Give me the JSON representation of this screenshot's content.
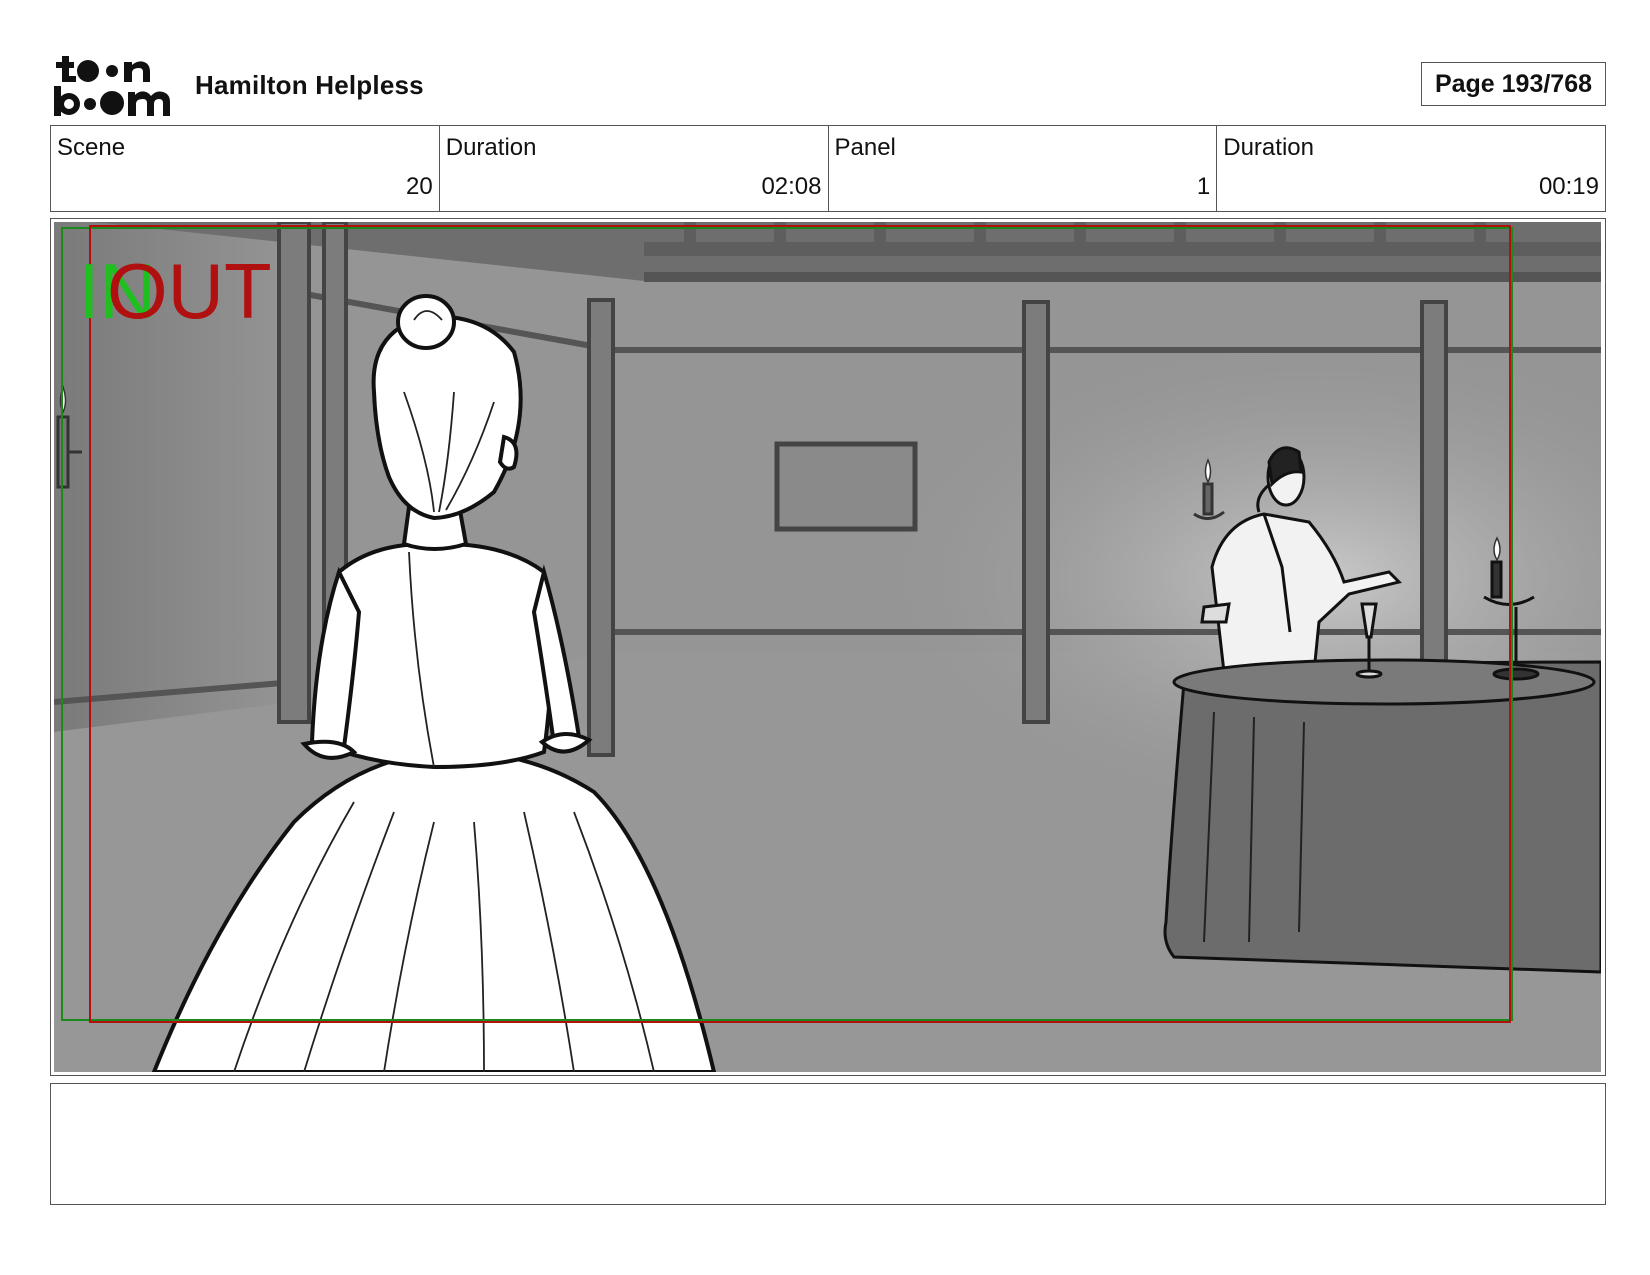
{
  "header": {
    "logo_text": "toon boom",
    "project_title": "Hamilton Helpless",
    "page_indicator": "Page 193/768"
  },
  "info": {
    "scene_label": "Scene",
    "scene_value": "20",
    "scene_duration_label": "Duration",
    "scene_duration_value": "02:08",
    "panel_label": "Panel",
    "panel_value": "1",
    "panel_duration_label": "Duration",
    "panel_duration_value": "00:19"
  },
  "panel": {
    "in_marker": "IN",
    "out_marker": "OUT",
    "in_color": "#1fbf1f",
    "out_color": "#b01010"
  },
  "notes": {
    "text": ""
  }
}
